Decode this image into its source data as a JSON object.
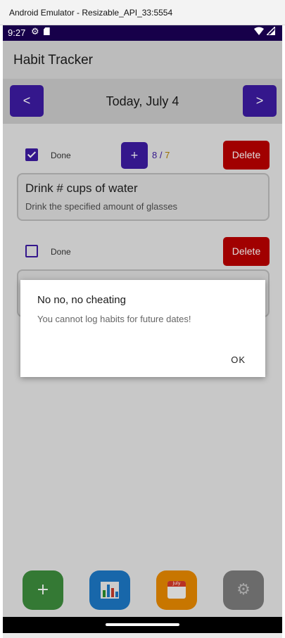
{
  "window": {
    "title": "Android Emulator - Resizable_API_33:5554"
  },
  "status_bar": {
    "time": "9:27",
    "left_icons": [
      "settings-gear-icon",
      "sd-card-icon"
    ],
    "right_icons": [
      "wifi-icon",
      "signal-icon"
    ]
  },
  "app_bar": {
    "title": "Habit Tracker"
  },
  "date_nav": {
    "prev_label": "<",
    "next_label": ">",
    "date": "Today, July 4"
  },
  "habits": [
    {
      "done_label": "Done",
      "checked": true,
      "plus_label": "+",
      "count": "8",
      "sep": "/",
      "goal": "7",
      "delete_label": "Delete",
      "name": "Drink # cups of water",
      "description": "Drink the specified amount of glasses"
    },
    {
      "done_label": "Done",
      "checked": false,
      "delete_label": "Delete"
    }
  ],
  "dialog": {
    "title": "No no, no cheating",
    "message": "You cannot log habits for future dates!",
    "ok_label": "OK"
  },
  "fabs": [
    {
      "name": "add",
      "label": "+",
      "color": "#3c8a3c"
    },
    {
      "name": "stats",
      "icon": "bar-chart-icon",
      "color": "#1c76c2"
    },
    {
      "name": "calendar",
      "icon": "calendar-icon",
      "month": "July",
      "day": "17",
      "color": "#e48700"
    },
    {
      "name": "settings",
      "icon": "gear-icon",
      "color": "#7a7a7a"
    }
  ],
  "colors": {
    "primary": "#3c1ba0",
    "danger": "#b80000",
    "status_bar": "#17004a"
  }
}
